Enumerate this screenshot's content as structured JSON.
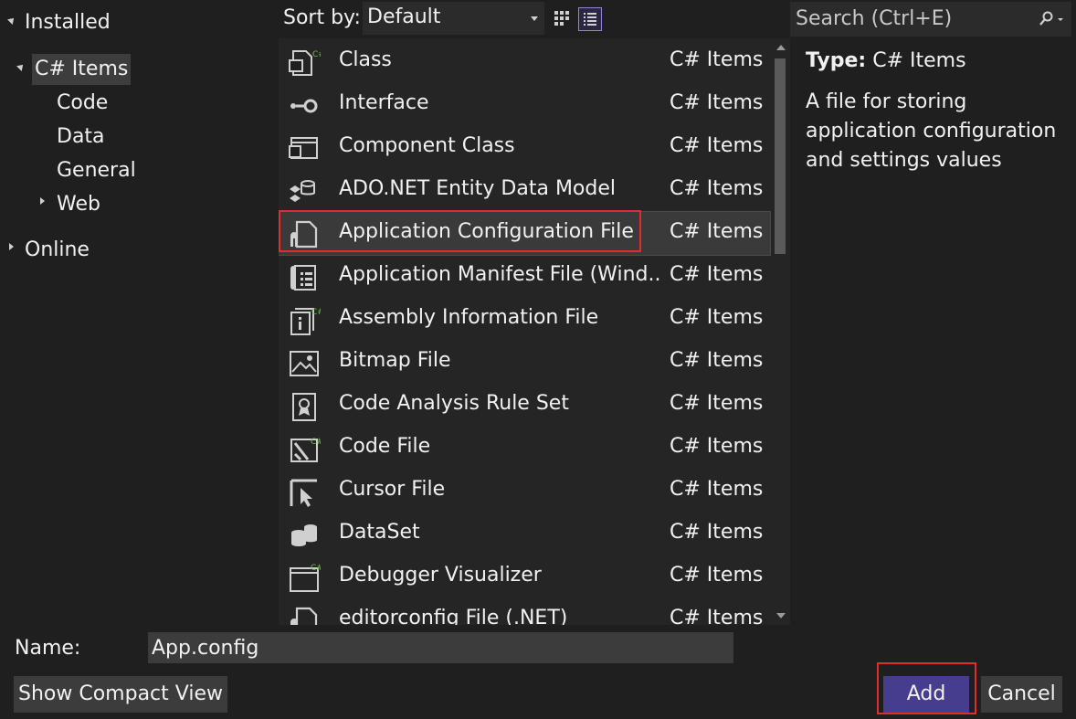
{
  "tree": {
    "installed": "Installed",
    "csharp_items": "C# Items",
    "code": "Code",
    "data": "Data",
    "general": "General",
    "web": "Web",
    "online": "Online"
  },
  "toolbar": {
    "sort_label": "Sort by:",
    "sort_value": "Default",
    "search_placeholder": "Search (Ctrl+E)"
  },
  "items": [
    {
      "name": "Class",
      "category": "C# Items",
      "icon": "class-icon"
    },
    {
      "name": "Interface",
      "category": "C# Items",
      "icon": "interface-icon"
    },
    {
      "name": "Component Class",
      "category": "C# Items",
      "icon": "component-class-icon"
    },
    {
      "name": "ADO.NET Entity Data Model",
      "category": "C# Items",
      "icon": "entity-data-model-icon"
    },
    {
      "name": "Application Configuration File",
      "category": "C# Items",
      "icon": "config-file-icon"
    },
    {
      "name": "Application Manifest File (Wind...",
      "category": "C# Items",
      "icon": "manifest-file-icon"
    },
    {
      "name": "Assembly Information File",
      "category": "C# Items",
      "icon": "assembly-info-icon"
    },
    {
      "name": "Bitmap File",
      "category": "C# Items",
      "icon": "bitmap-file-icon"
    },
    {
      "name": "Code Analysis Rule Set",
      "category": "C# Items",
      "icon": "rule-set-icon"
    },
    {
      "name": "Code File",
      "category": "C# Items",
      "icon": "code-file-icon"
    },
    {
      "name": "Cursor File",
      "category": "C# Items",
      "icon": "cursor-file-icon"
    },
    {
      "name": "DataSet",
      "category": "C# Items",
      "icon": "dataset-icon"
    },
    {
      "name": "Debugger Visualizer",
      "category": "C# Items",
      "icon": "debugger-visualizer-icon"
    },
    {
      "name": "editorconfig File (.NET)",
      "category": "C# Items",
      "icon": "editorconfig-icon"
    }
  ],
  "details": {
    "type_label": "Type:",
    "type_value": "C# Items",
    "description": "A file for storing application configuration and settings values"
  },
  "bottom": {
    "name_label": "Name:",
    "name_value": "App.config",
    "compact_view": "Show Compact View",
    "add": "Add",
    "cancel": "Cancel"
  },
  "colors": {
    "background": "#1f1f1f",
    "accent_button": "#473d8e",
    "highlight": "#e02e2e",
    "csharp_badge": "#6fbf4a"
  }
}
